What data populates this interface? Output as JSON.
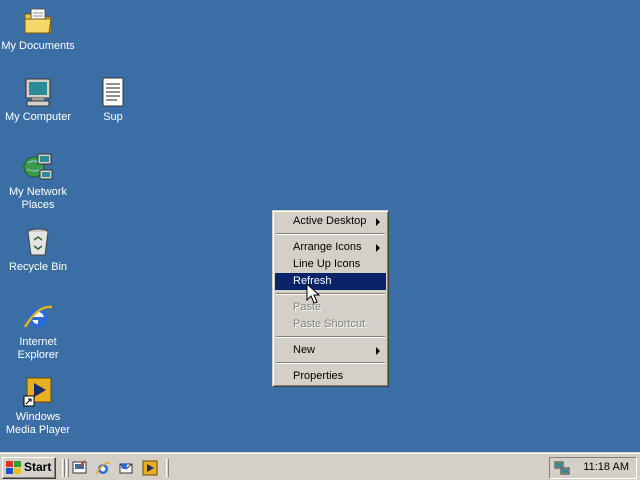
{
  "desktop": {
    "background": "#3a6ea5",
    "icons": [
      {
        "label": "My Documents",
        "icon": "folder-documents-icon"
      },
      {
        "label": "My Computer",
        "icon": "computer-icon"
      },
      {
        "label": "Sup",
        "icon": "text-document-icon"
      },
      {
        "label": "My Network Places",
        "icon": "network-places-icon"
      },
      {
        "label": "Recycle Bin",
        "icon": "recycle-bin-icon"
      },
      {
        "label": "Internet Explorer",
        "icon": "internet-explorer-icon"
      },
      {
        "label": "Windows Media Player",
        "icon": "media-player-icon"
      }
    ]
  },
  "context_menu": {
    "items": [
      {
        "label": "Active Desktop",
        "submenu": true,
        "enabled": true
      },
      {
        "label": "Arrange Icons",
        "submenu": true,
        "enabled": true
      },
      {
        "label": "Line Up Icons",
        "submenu": false,
        "enabled": true
      },
      {
        "label": "Refresh",
        "submenu": false,
        "enabled": true,
        "highlighted": true
      },
      {
        "label": "Paste",
        "submenu": false,
        "enabled": false
      },
      {
        "label": "Paste Shortcut",
        "submenu": false,
        "enabled": false
      },
      {
        "label": "New",
        "submenu": true,
        "enabled": true
      },
      {
        "label": "Properties",
        "submenu": false,
        "enabled": true
      }
    ],
    "highlight_color": "#0a246a"
  },
  "taskbar": {
    "start_label": "Start",
    "quick_launch": [
      "show-desktop-icon",
      "internet-explorer-icon",
      "outlook-express-icon",
      "media-player-icon"
    ],
    "clock": "11:18 AM",
    "tray_icon": "network-connection-icon"
  }
}
